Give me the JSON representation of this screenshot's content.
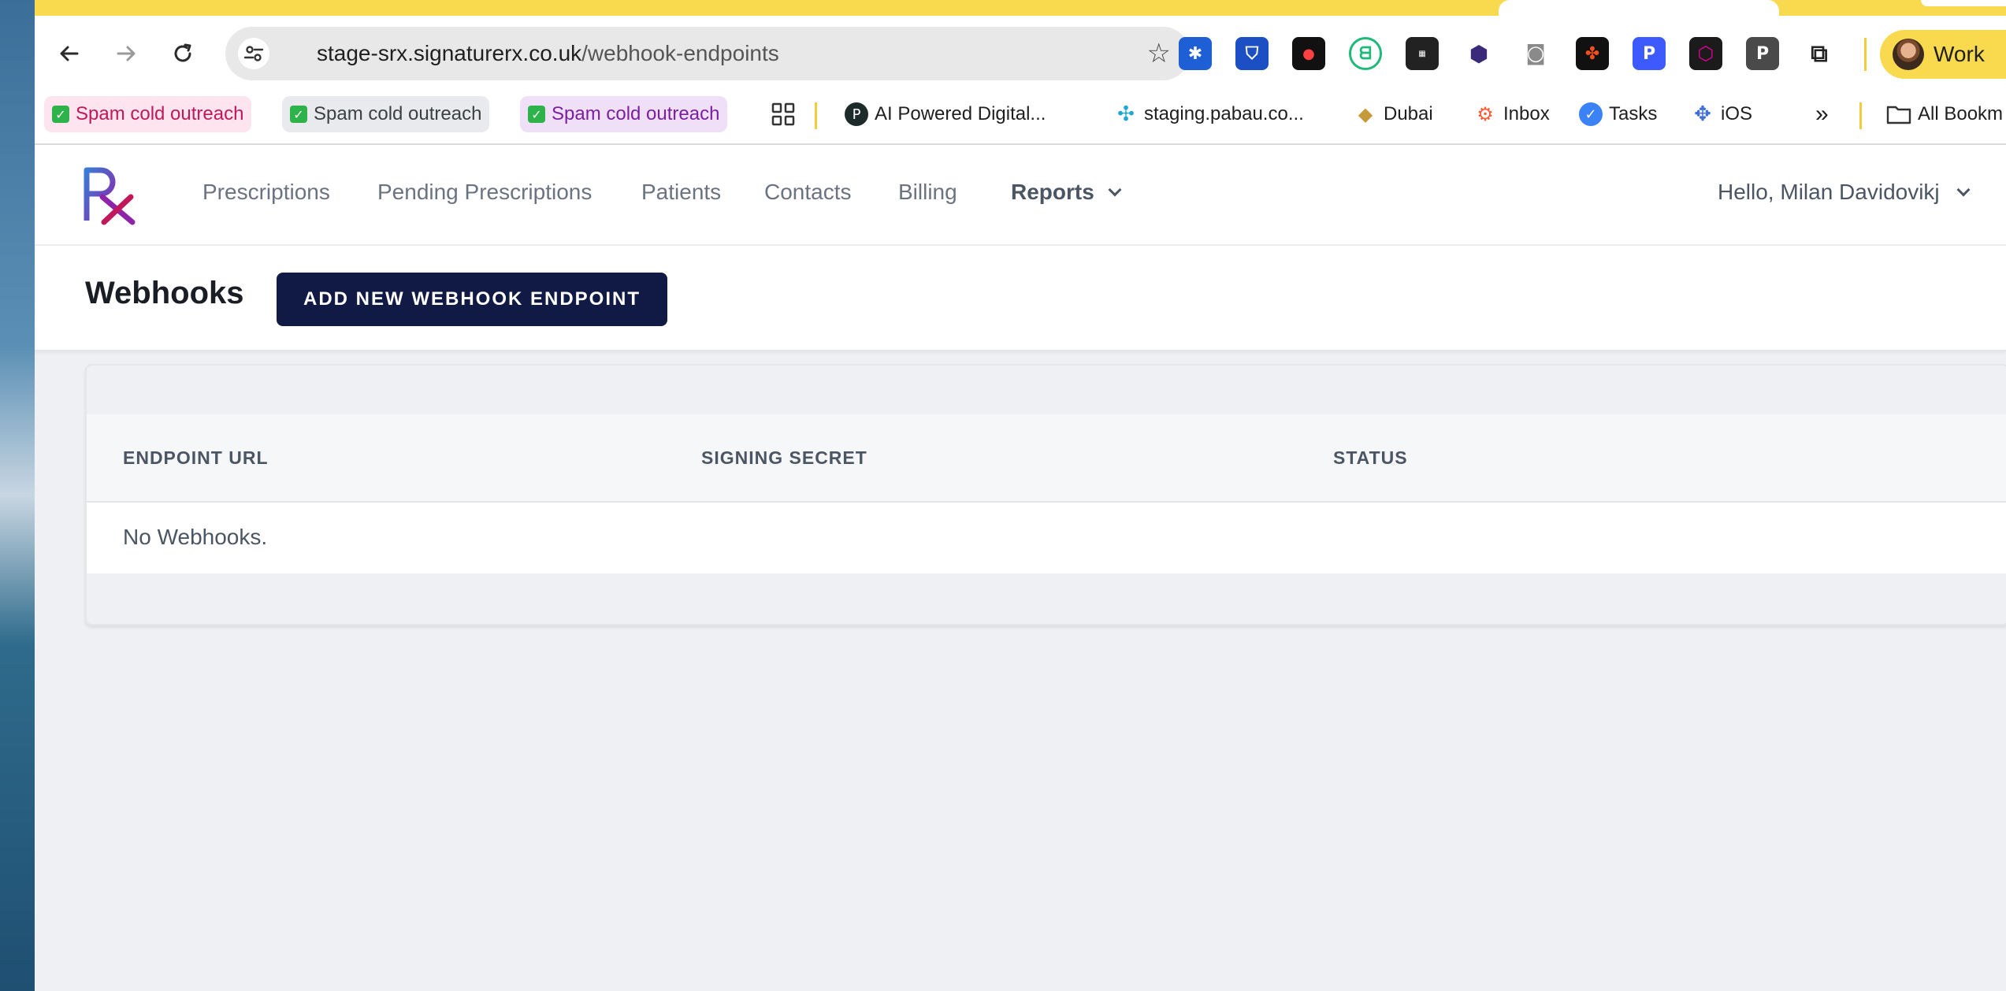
{
  "browser": {
    "url_host": "stage-srx.signaturerx.co.uk",
    "url_path": "/webhook-endpoints",
    "profile_label": "Work",
    "bookmarks": [
      {
        "label": "Spam cold outreach",
        "color": "#c2185b",
        "bg": "#fde4ee"
      },
      {
        "label": "Spam cold outreach",
        "color": "#3c4043",
        "bg": "#e8eaed"
      },
      {
        "label": "Spam cold outreach",
        "color": "#7b1fa2",
        "bg": "#efe0f7"
      },
      {
        "label": "AI Powered Digital..."
      },
      {
        "label": "staging.pabau.co..."
      },
      {
        "label": "Dubai"
      },
      {
        "label": "Inbox"
      },
      {
        "label": "Tasks"
      },
      {
        "label": "iOS"
      },
      {
        "label": "All Bookm"
      }
    ],
    "more_bookmarks_glyph": "»"
  },
  "app": {
    "nav": {
      "prescriptions": "Prescriptions",
      "pending_prescriptions": "Pending Prescriptions",
      "patients": "Patients",
      "contacts": "Contacts",
      "billing": "Billing",
      "reports": "Reports"
    },
    "user_greeting": "Hello, Milan Davidovikj",
    "brand_color_primary": "#111a44"
  },
  "page": {
    "title": "Webhooks",
    "add_button_label": "ADD NEW WEBHOOK ENDPOINT"
  },
  "table": {
    "columns": [
      "ENDPOINT URL",
      "SIGNING SECRET",
      "STATUS"
    ],
    "empty_message": "No Webhooks."
  }
}
